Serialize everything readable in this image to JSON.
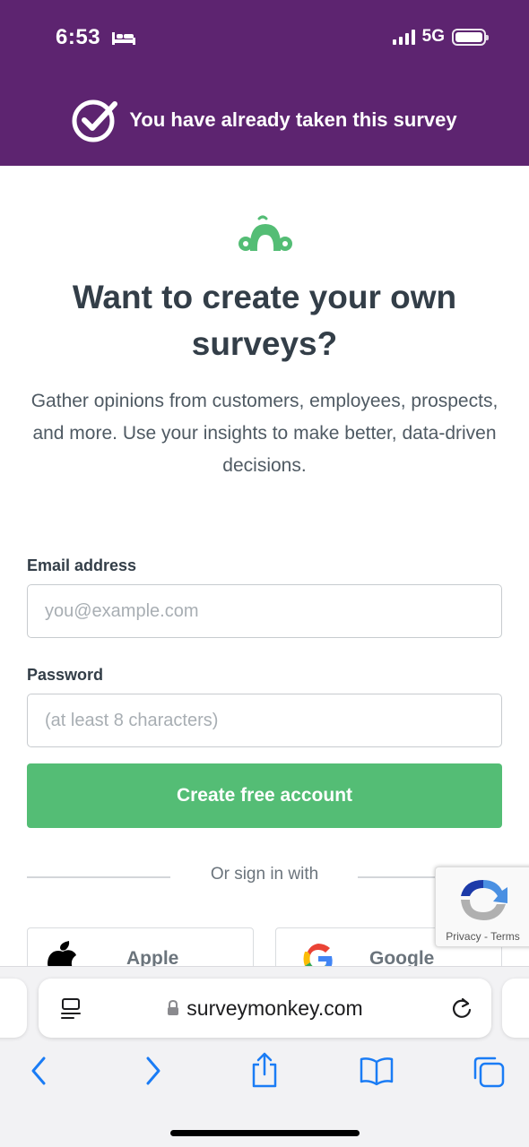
{
  "status_bar": {
    "time": "6:53",
    "network": "5G"
  },
  "banner": {
    "text": "You have already taken this survey"
  },
  "hero": {
    "title": "Want to create your own surveys?",
    "subtitle": "Gather opinions from customers, employees, prospects, and more. Use your insights to make better, data-driven decisions."
  },
  "form": {
    "email_label": "Email address",
    "email_placeholder": "you@example.com",
    "password_label": "Password",
    "password_placeholder": "(at least 8 characters)",
    "submit_label": "Create free account"
  },
  "social": {
    "divider_text": "Or sign in with",
    "apple_label": "Apple",
    "google_label": "Google"
  },
  "recaptcha": {
    "privacy": "Privacy",
    "separator": " - ",
    "terms": "Terms"
  },
  "browser": {
    "url": "surveymonkey.com"
  },
  "colors": {
    "header_purple": "#5d2470",
    "brand_green": "#54bd75",
    "text_dark": "#333e48",
    "ios_blue": "#1a7cf5"
  }
}
